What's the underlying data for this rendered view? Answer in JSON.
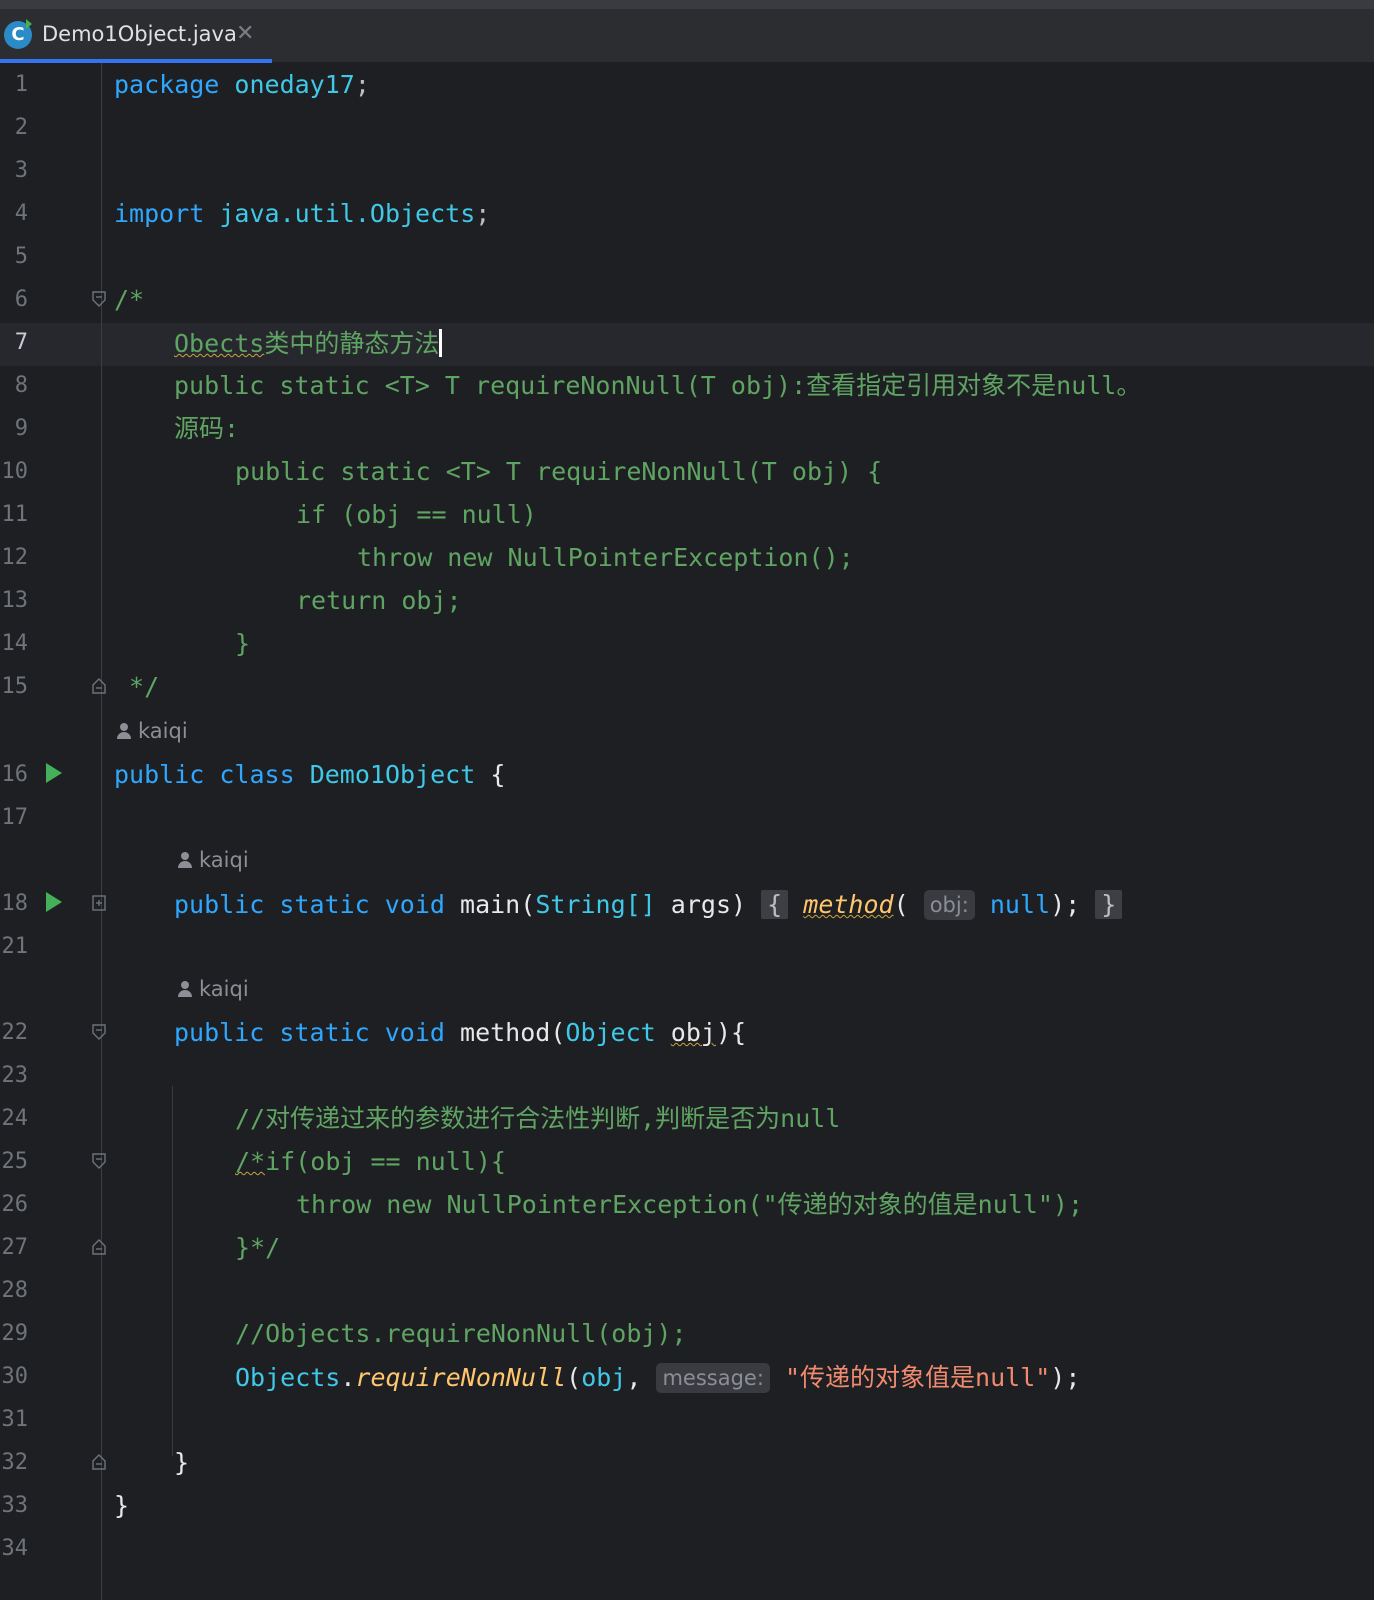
{
  "tab": {
    "title": "Demo1Object.java",
    "close": "✕",
    "icon": "java-class-icon"
  },
  "authors": {
    "a1": "kaiqi",
    "a2": "kaiqi",
    "a3": "kaiqi"
  },
  "code": {
    "l1_kw": "package",
    "l1_name": "oneday17",
    "l1_semi": ";",
    "l4_kw": "import",
    "l4_name": "java.util.Objects",
    "l4_semi": ";",
    "l6": "/*",
    "l7_a": "Obects",
    "l7_b": "类中的静态方法",
    "l8": "public static <T> T requireNonNull(T obj):查看指定引用对象不是null。",
    "l9": "源码:",
    "l10": "public static <T> T requireNonNull(T obj) {",
    "l11": "if (obj == null)",
    "l12": "throw new NullPointerException();",
    "l13": "return obj;",
    "l14": "}",
    "l15": " */",
    "l16_public": "public",
    "l16_class": "class",
    "l16_name": "Demo1Object",
    "l16_brace": " {",
    "l18_public": "public",
    "l18_static": "static",
    "l18_void": "void",
    "l18_main": "main",
    "l18_open": "(",
    "l18_string": "String[]",
    "l18_args": "args",
    "l18_close": ")",
    "l18_fold_open": "{",
    "l18_method": "method",
    "l18_paren": "(",
    "l18_hint": "obj:",
    "l18_null": "null",
    "l18_end": ");",
    "l18_fold_close": "}",
    "l22_public": "public",
    "l22_static": "static",
    "l22_void": "void",
    "l22_method": "method",
    "l22_open": "(",
    "l22_object": "Object",
    "l22_obj": "obj",
    "l22_close": "){",
    "l24": "//对传递过来的参数进行合法性判断,判断是否为null",
    "l25_a": "/*",
    "l25_b": "if(obj == null){",
    "l26": "throw new NullPointerException(\"传递的对象的值是null\");",
    "l27": "}*/",
    "l29": "//Objects.requireNonNull(obj);",
    "l30_objects": "Objects",
    "l30_dot": ".",
    "l30_method": "requireNonNull",
    "l30_open": "(",
    "l30_obj": "obj",
    "l30_comma": ", ",
    "l30_hint": "message:",
    "l30_str": "\"传递的对象值是null\"",
    "l30_end": ");",
    "l32": "}",
    "l33": "}"
  },
  "line_numbers": {
    "n1": "1",
    "n2": "2",
    "n3": "3",
    "n4": "4",
    "n5": "5",
    "n6": "6",
    "n7": "7",
    "n8": "8",
    "n9": "9",
    "n10": "10",
    "n11": "11",
    "n12": "12",
    "n13": "13",
    "n14": "14",
    "n15": "15",
    "n16": "16",
    "n17": "17",
    "n18": "18",
    "n21": "21",
    "n22": "22",
    "n23": "23",
    "n24": "24",
    "n25": "25",
    "n26": "26",
    "n27": "27",
    "n28": "28",
    "n29": "29",
    "n30": "30",
    "n31": "31",
    "n32": "32",
    "n33": "33",
    "n34": "34"
  },
  "icons": {
    "run": "run-icon",
    "fold": "fold-icon",
    "expand": "expand-icon",
    "author": "person-icon"
  },
  "colors": {
    "keyword": "#2fa7ff",
    "type": "#3fc8e8",
    "comment": "#5fa463",
    "string": "#f08a6e",
    "method": "#ffc66d"
  }
}
